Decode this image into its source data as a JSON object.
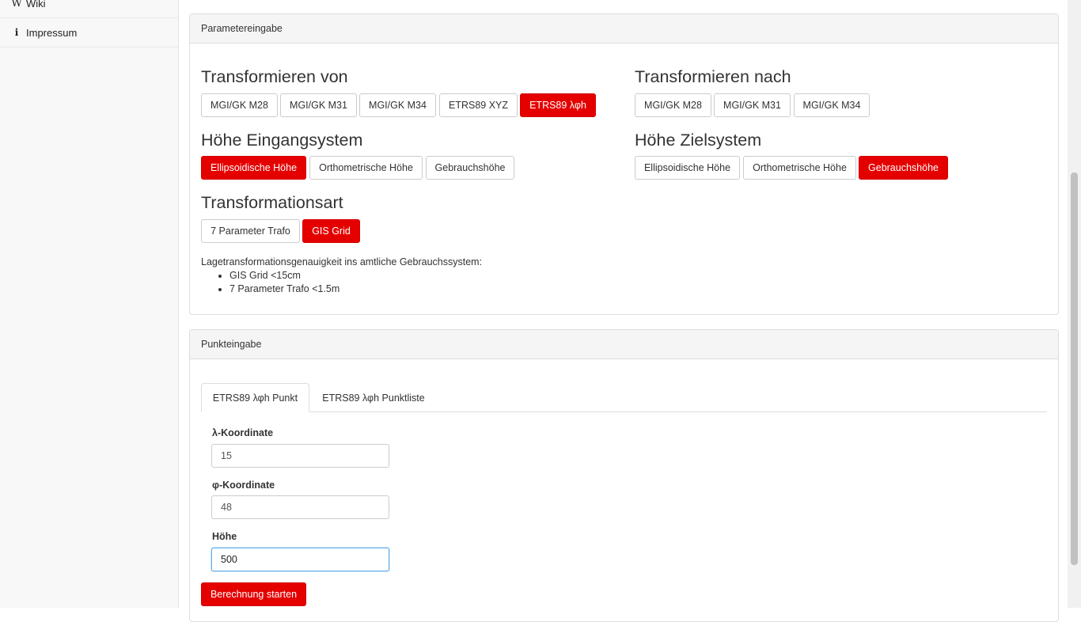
{
  "sidebar": {
    "items": [
      {
        "label": "Wiki",
        "icon": "wikipedia-icon",
        "icon_glyph": "W"
      },
      {
        "label": "Impressum",
        "icon": "info-icon",
        "icon_glyph": "i"
      }
    ]
  },
  "params": {
    "heading": "Parametereingabe",
    "from": {
      "title": "Transformieren von",
      "options": [
        "MGI/GK M28",
        "MGI/GK M31",
        "MGI/GK M34",
        "ETRS89 XYZ",
        "ETRS89 λφh"
      ],
      "selected": "ETRS89 λφh"
    },
    "to": {
      "title": "Transformieren nach",
      "options": [
        "MGI/GK M28",
        "MGI/GK M31",
        "MGI/GK M34"
      ],
      "selected": ""
    },
    "height_in": {
      "title": "Höhe Eingangsystem",
      "options": [
        "Ellipsoidische Höhe",
        "Orthometrische Höhe",
        "Gebrauchshöhe"
      ],
      "selected": "Ellipsoidische Höhe"
    },
    "height_out": {
      "title": "Höhe Zielsystem",
      "options": [
        "Ellipsoidische Höhe",
        "Orthometrische Höhe",
        "Gebrauchshöhe"
      ],
      "selected": "Gebrauchshöhe"
    },
    "trafo": {
      "title": "Transformationsart",
      "options": [
        "7 Parameter Trafo",
        "GIS Grid"
      ],
      "selected": "GIS Grid"
    },
    "accuracy": {
      "text": "Lagetransformationsgenauigkeit ins amtliche Gebrauchssystem:",
      "items": [
        "GIS Grid <15cm",
        "7 Parameter Trafo <1.5m"
      ]
    }
  },
  "points": {
    "heading": "Punkteingabe",
    "tabs": [
      "ETRS89 λφh Punkt",
      "ETRS89 λφh Punktliste"
    ],
    "active_tab": "ETRS89 λφh Punkt",
    "fields": [
      {
        "label": "λ-Koordinate",
        "value": "15"
      },
      {
        "label": "φ-Koordinate",
        "value": "48"
      },
      {
        "label": "Höhe",
        "value": "500"
      }
    ],
    "submit_label": "Berechnung starten"
  },
  "colors": {
    "accent": "#e50000",
    "panel_heading_bg": "#f5f5f5",
    "sidebar_bg": "#f8f8f8"
  }
}
